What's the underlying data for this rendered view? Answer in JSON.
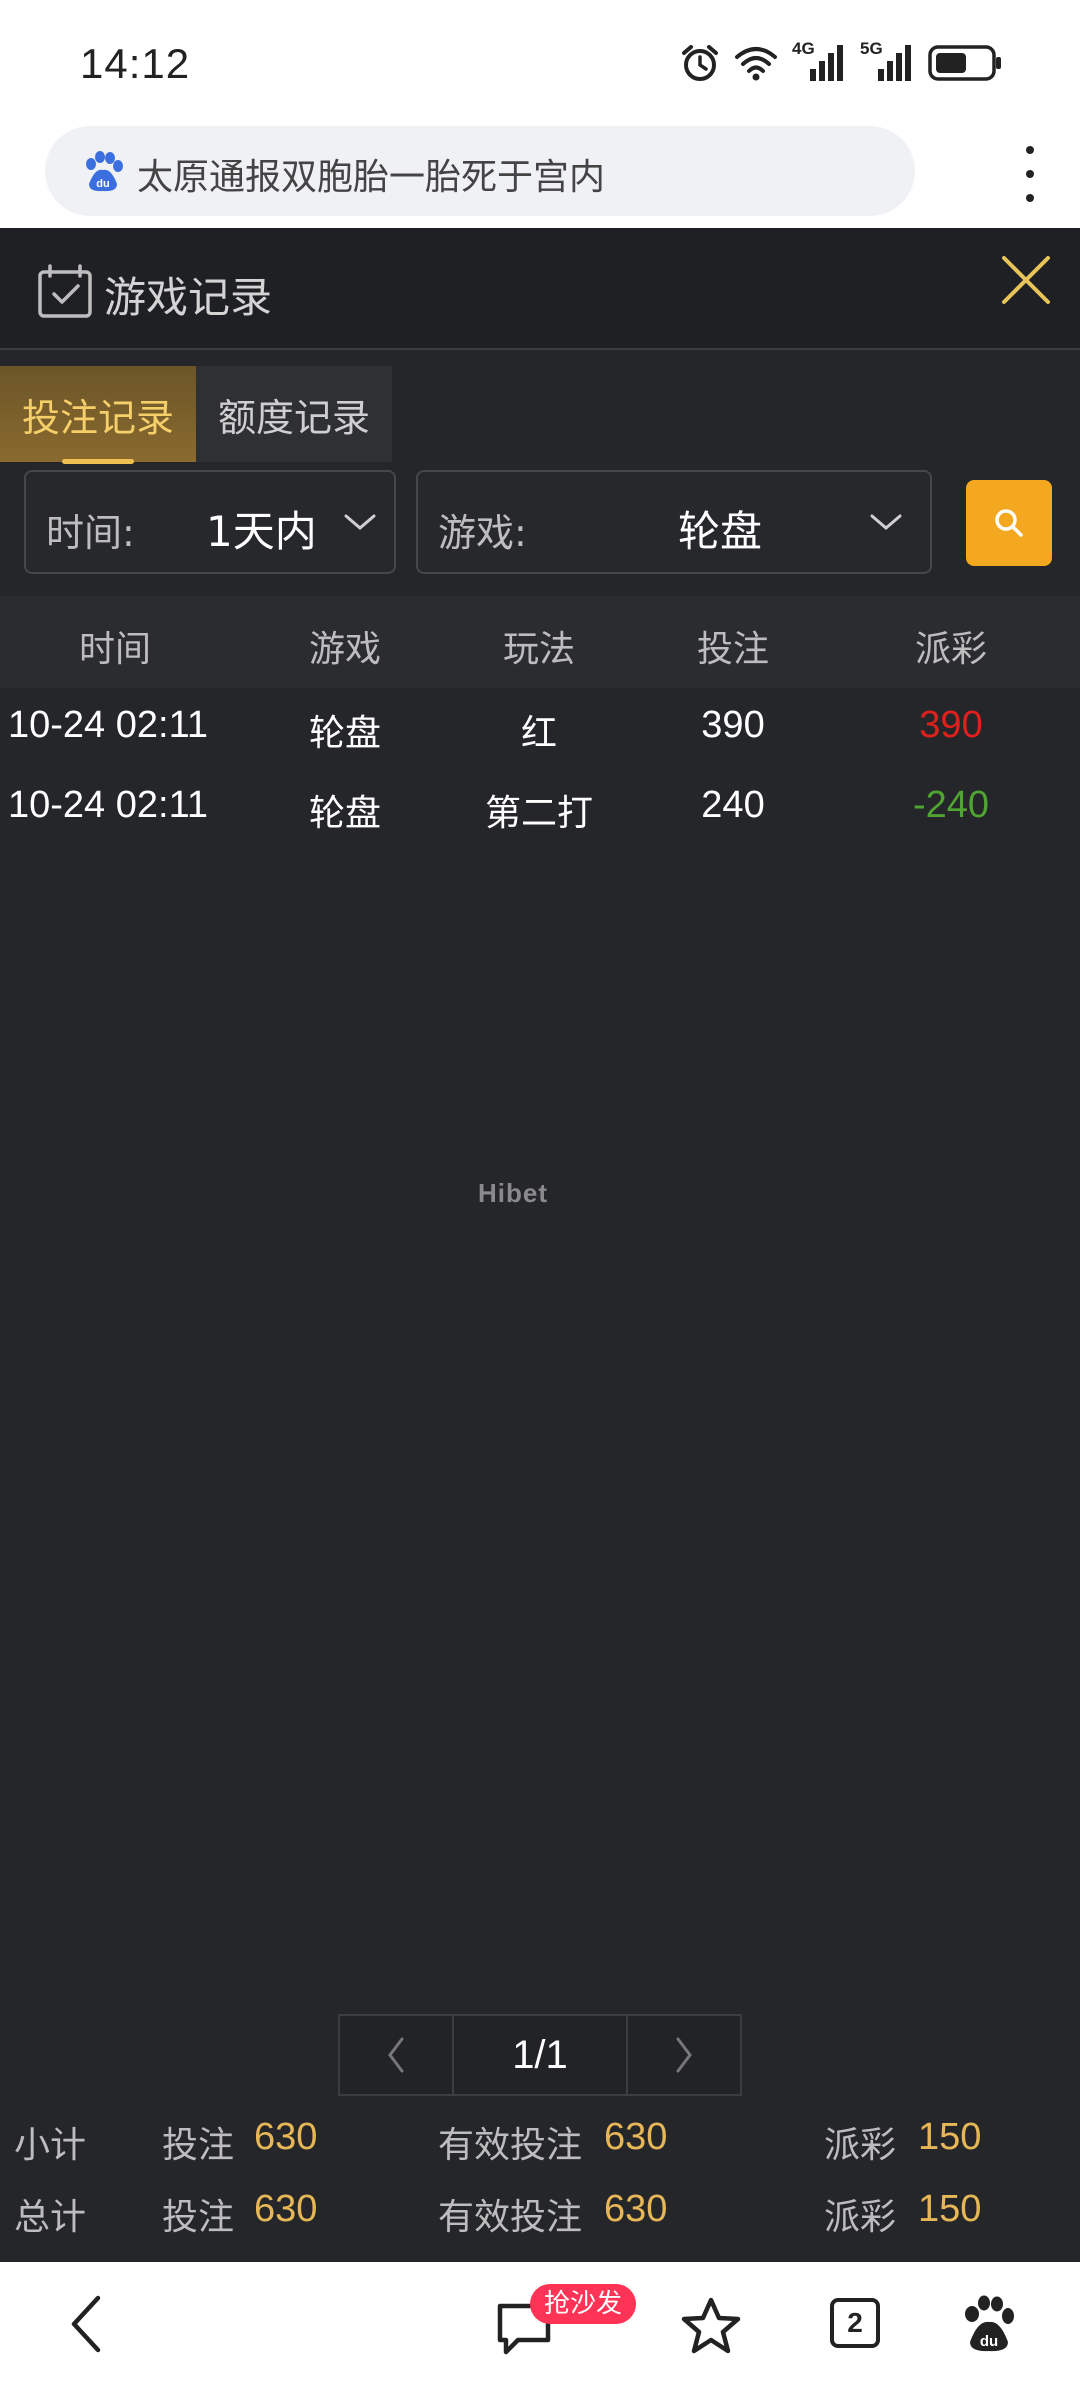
{
  "status_bar": {
    "time": "14:12",
    "network_1": "4G",
    "network_2": "5G"
  },
  "browser": {
    "search_text": "太原通报双胞胎一胎死于宫内"
  },
  "panel": {
    "title": "游戏记录",
    "tabs": [
      {
        "label": "投注记录",
        "active": true
      },
      {
        "label": "额度记录",
        "active": false
      }
    ],
    "filters": {
      "time_label": "时间:",
      "time_value": "1天内",
      "game_label": "游戏:",
      "game_value": "轮盘"
    },
    "table": {
      "headers": [
        "时间",
        "游戏",
        "玩法",
        "投注",
        "派彩"
      ],
      "rows": [
        {
          "time": "10-24 02:11",
          "game": "轮盘",
          "play": "红",
          "bet": "390",
          "payout": "390",
          "payout_color": "#e0201c"
        },
        {
          "time": "10-24 02:11",
          "game": "轮盘",
          "play": "第二打",
          "bet": "240",
          "payout": "-240",
          "payout_color": "#4fa432"
        }
      ]
    },
    "watermark": "Hibet",
    "pagination": {
      "page": "1/1"
    },
    "summary": [
      {
        "label": "小计",
        "bet_label": "投注",
        "bet": "630",
        "valid_label": "有效投注",
        "valid": "630",
        "payout_label": "派彩",
        "payout": "150"
      },
      {
        "label": "总计",
        "bet_label": "投注",
        "bet": "630",
        "valid_label": "有效投注",
        "valid": "630",
        "payout_label": "派彩",
        "payout": "150"
      }
    ]
  },
  "bottom_nav": {
    "comment_badge": "抢沙发",
    "tab_count": "2"
  },
  "colors": {
    "accent": "#f3a81f",
    "gold_text": "#e7b757",
    "panel_bg": "#25262a"
  }
}
